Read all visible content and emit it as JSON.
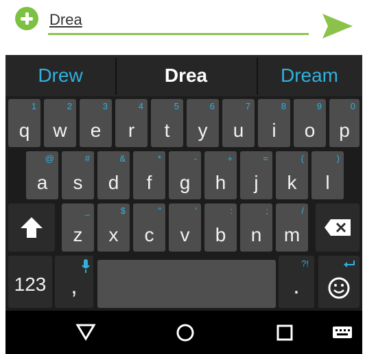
{
  "compose": {
    "message_text": "Drea",
    "accent_color": "#8bc34a",
    "add_icon": "plus-circle-icon",
    "send_icon": "send-arrow-icon"
  },
  "keyboard": {
    "suggestions": [
      "Drew",
      "Drea",
      "Dream"
    ],
    "row1": [
      {
        "label": "q",
        "hint": "1"
      },
      {
        "label": "w",
        "hint": "2"
      },
      {
        "label": "e",
        "hint": "3"
      },
      {
        "label": "r",
        "hint": "4"
      },
      {
        "label": "t",
        "hint": "5"
      },
      {
        "label": "y",
        "hint": "6"
      },
      {
        "label": "u",
        "hint": "7"
      },
      {
        "label": "i",
        "hint": "8"
      },
      {
        "label": "o",
        "hint": "9"
      },
      {
        "label": "p",
        "hint": "0"
      }
    ],
    "row2": [
      {
        "label": "a",
        "hint": "@"
      },
      {
        "label": "s",
        "hint": "#"
      },
      {
        "label": "d",
        "hint": "&"
      },
      {
        "label": "f",
        "hint": "*"
      },
      {
        "label": "g",
        "hint": "-"
      },
      {
        "label": "h",
        "hint": "+"
      },
      {
        "label": "j",
        "hint": "="
      },
      {
        "label": "k",
        "hint": "("
      },
      {
        "label": "l",
        "hint": ")"
      }
    ],
    "row3": [
      {
        "label": "z",
        "hint": "_"
      },
      {
        "label": "x",
        "hint": "$"
      },
      {
        "label": "c",
        "hint": "\""
      },
      {
        "label": "v",
        "hint": "'"
      },
      {
        "label": "b",
        "hint": ":"
      },
      {
        "label": "n",
        "hint": ";"
      },
      {
        "label": "m",
        "hint": "/"
      }
    ],
    "numbers_key": "123",
    "comma_key": ",",
    "period_key": ".",
    "period_hint": "?!",
    "shift_icon": "shift-arrow-icon",
    "delete_icon": "backspace-icon",
    "mic_icon": "microphone-icon",
    "emoji_icon": "emoji-face-icon"
  },
  "navbar": {
    "back_icon": "back-triangle-icon",
    "home_icon": "home-circle-icon",
    "recents_icon": "recents-square-icon",
    "keyboard_icon": "keyboard-switch-icon"
  },
  "colors": {
    "suggestion_highlight": "#2fb1e0",
    "key_bg": "#4d4d4d",
    "keyboard_bg": "#1c1c1c"
  }
}
